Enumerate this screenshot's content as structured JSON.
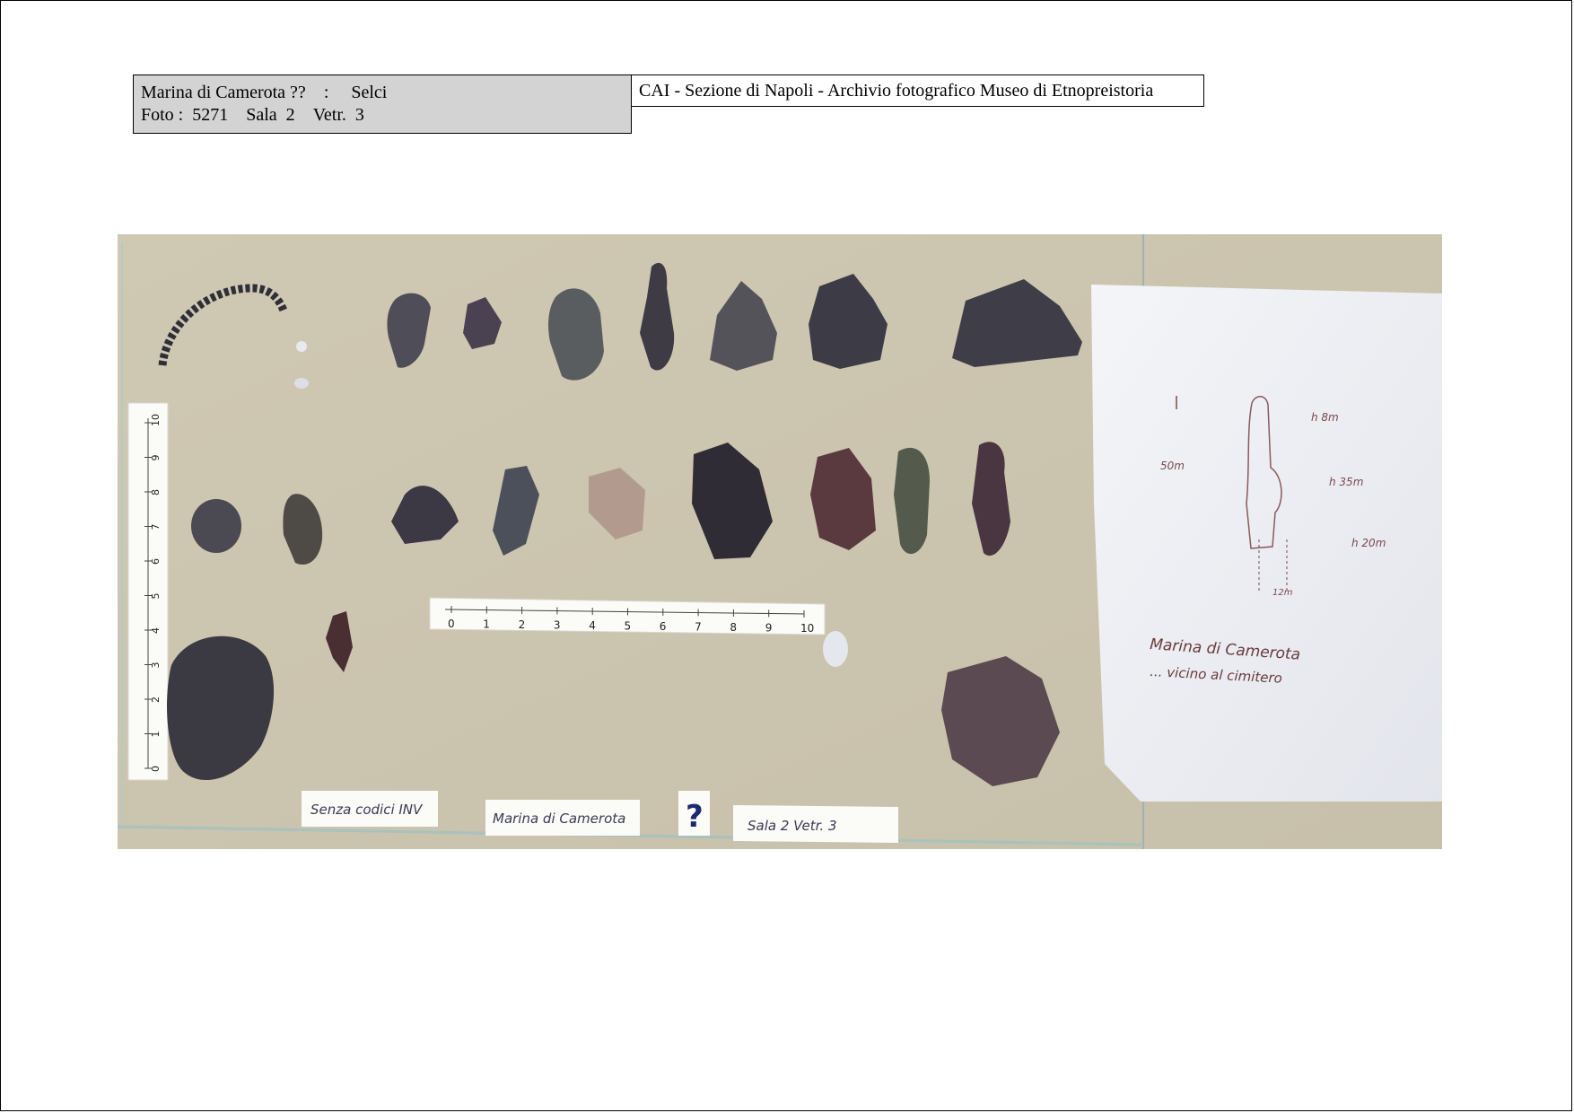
{
  "header": {
    "left": {
      "site": "Marina di Camerota ??",
      "separator": ":",
      "material": "Selci",
      "foto_label": "Foto :",
      "foto_number": "5271",
      "sala": "Sala  2",
      "vetrina": "Vetr.  3"
    },
    "right": {
      "archive": "CAI - Sezione di Napoli  - Archivio fotografico Museo di Etnopreistoria"
    }
  },
  "photo": {
    "scale_ticks": [
      "0",
      "1",
      "2",
      "3",
      "4",
      "5",
      "6",
      "7",
      "8",
      "9",
      "10"
    ],
    "labels": {
      "senza_codici": "Senza codici INV",
      "site_card": "Marina di Camerota",
      "question_card": "?",
      "sala_card": "Sala 2  Vetr. 3"
    },
    "note": {
      "line1": "Marina di Camerota",
      "line2": "... vicino al cimitero",
      "dim_50m": "50m",
      "dim_h8": "h 8m",
      "dim_h35": "h 35m",
      "dim_h20": "h 20m",
      "dim_12m": "12m"
    }
  }
}
